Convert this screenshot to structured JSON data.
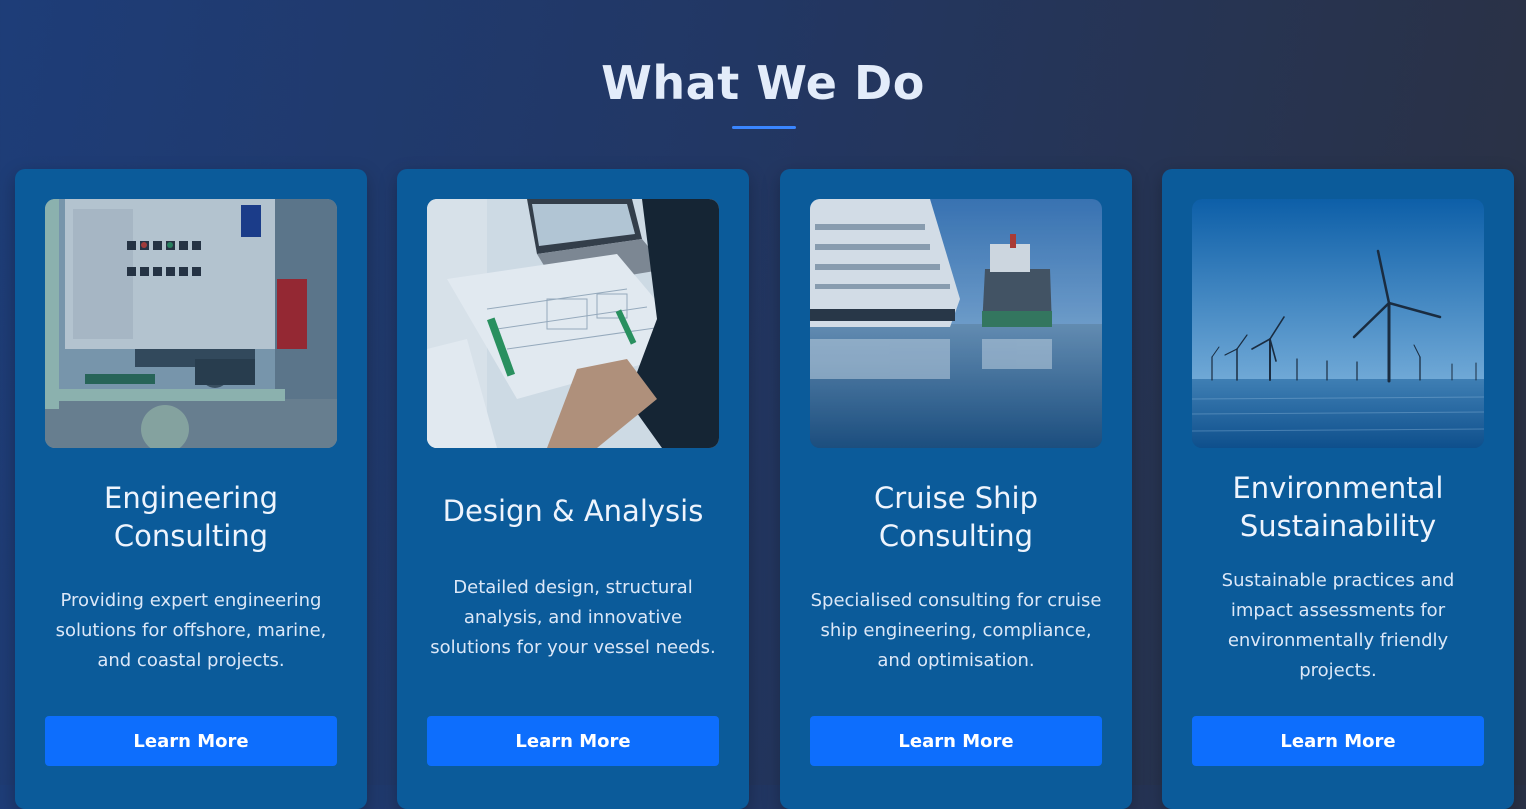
{
  "section": {
    "title": "What We Do",
    "accent_color": "#3a86ff",
    "card_color": "#0b5b9a",
    "button_color": "#0d6efd"
  },
  "cards": [
    {
      "image": "engineering-equipment-photo",
      "title": "Engineering\nConsulting",
      "description": "Providing expert engineering solutions for offshore, marine, and coastal projects.",
      "button_label": "Learn More"
    },
    {
      "image": "design-drawings-photo",
      "title": "Design & Analysis",
      "description": "Detailed design, structural analysis, and innovative solutions for your vessel needs.",
      "button_label": "Learn More"
    },
    {
      "image": "cruise-ship-photo",
      "title": "Cruise Ship\nConsulting",
      "description": "Specialised consulting for cruise ship engineering, compliance, and optimisation.",
      "button_label": "Learn More"
    },
    {
      "image": "offshore-wind-farm-photo",
      "title": "Environmental\nSustainability",
      "description": "Sustainable practices and impact assessments for environmentally friendly projects.",
      "button_label": "Learn More"
    }
  ]
}
